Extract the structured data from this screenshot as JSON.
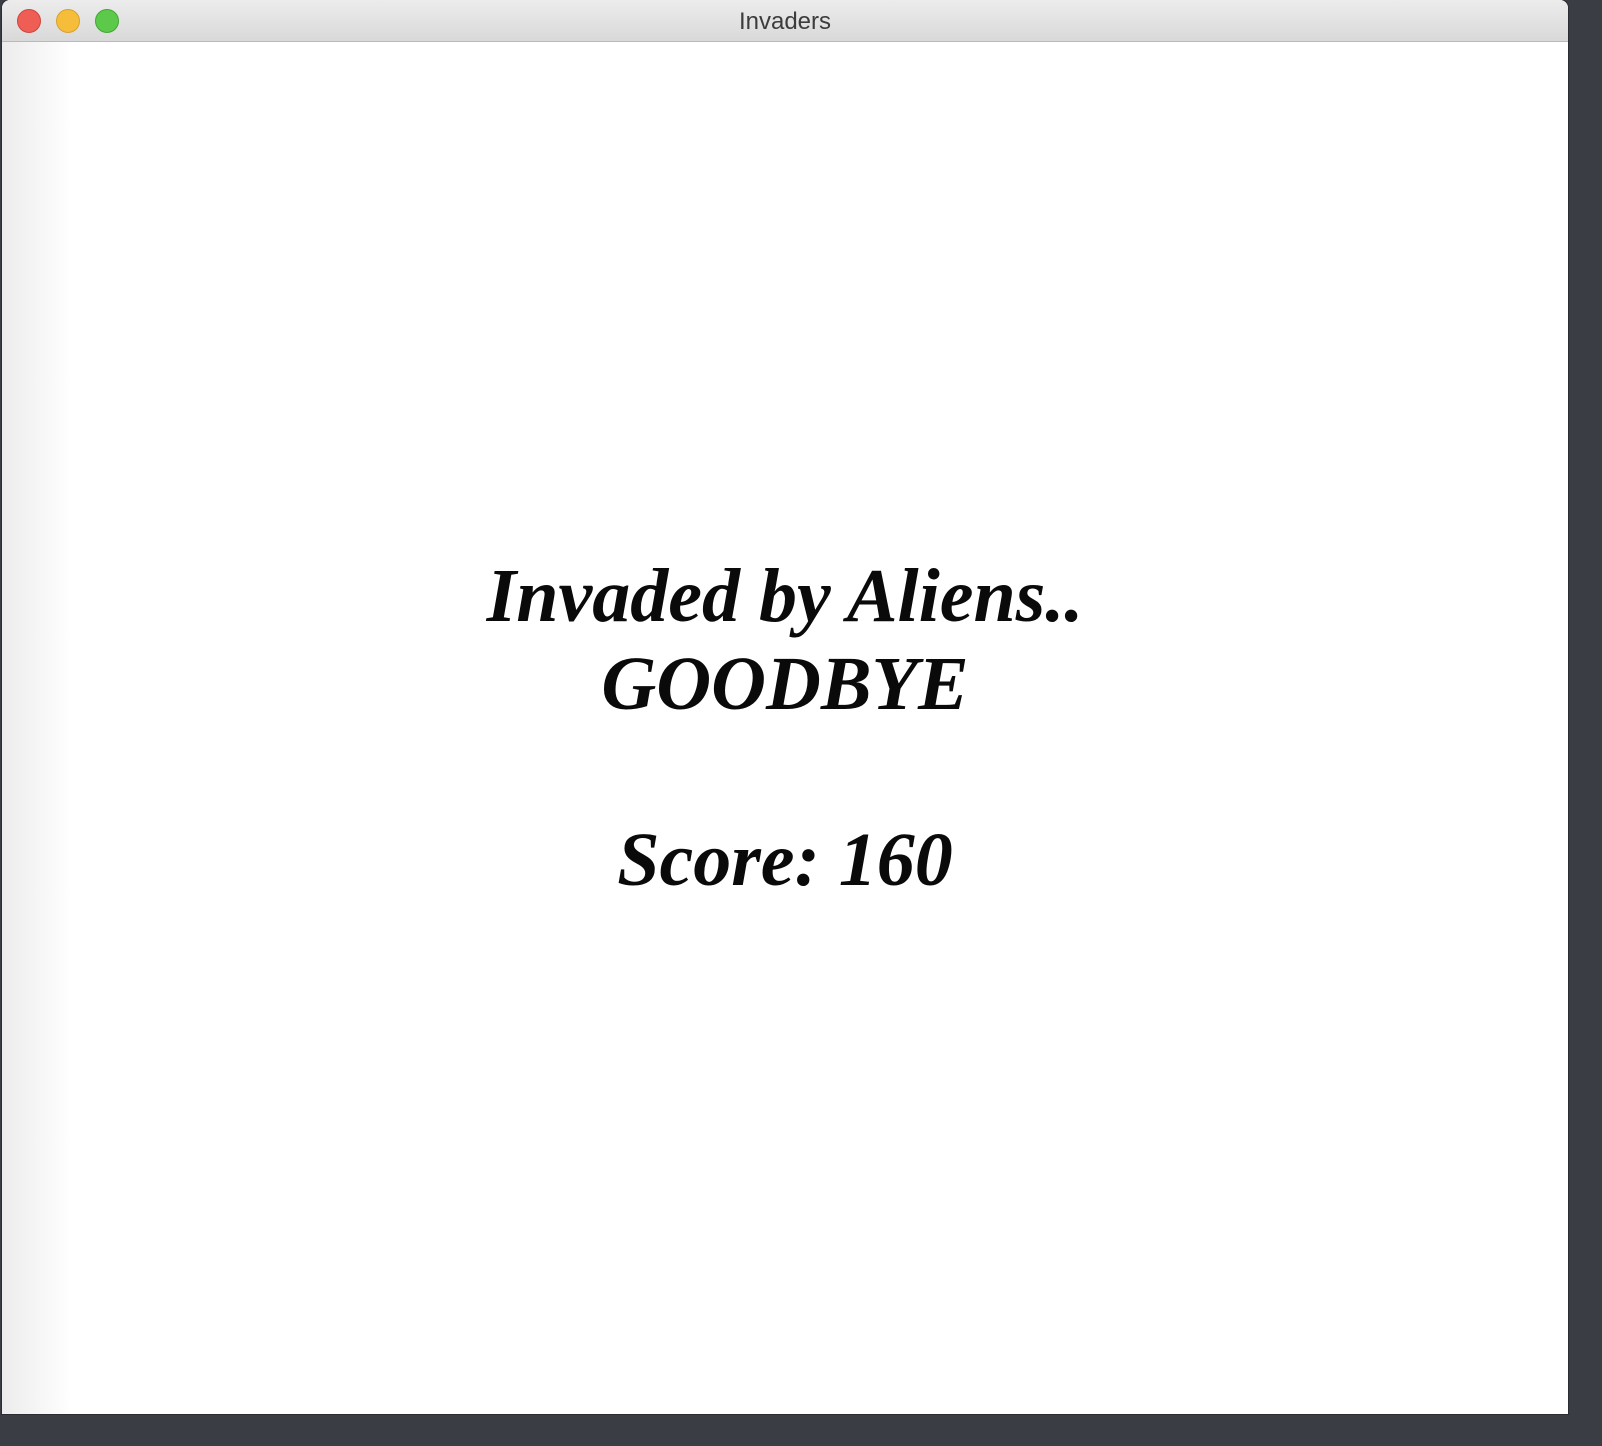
{
  "window": {
    "title": "Invaders"
  },
  "game_over": {
    "line1": "Invaded by Aliens..",
    "line2": "GOODBYE",
    "score_text": "Score: 160",
    "score": 160
  },
  "colors": {
    "close": "#ee5e55",
    "minimize": "#f6bd3b",
    "zoom": "#5dc94a",
    "text": "#0a0a0a",
    "background": "#ffffff"
  }
}
